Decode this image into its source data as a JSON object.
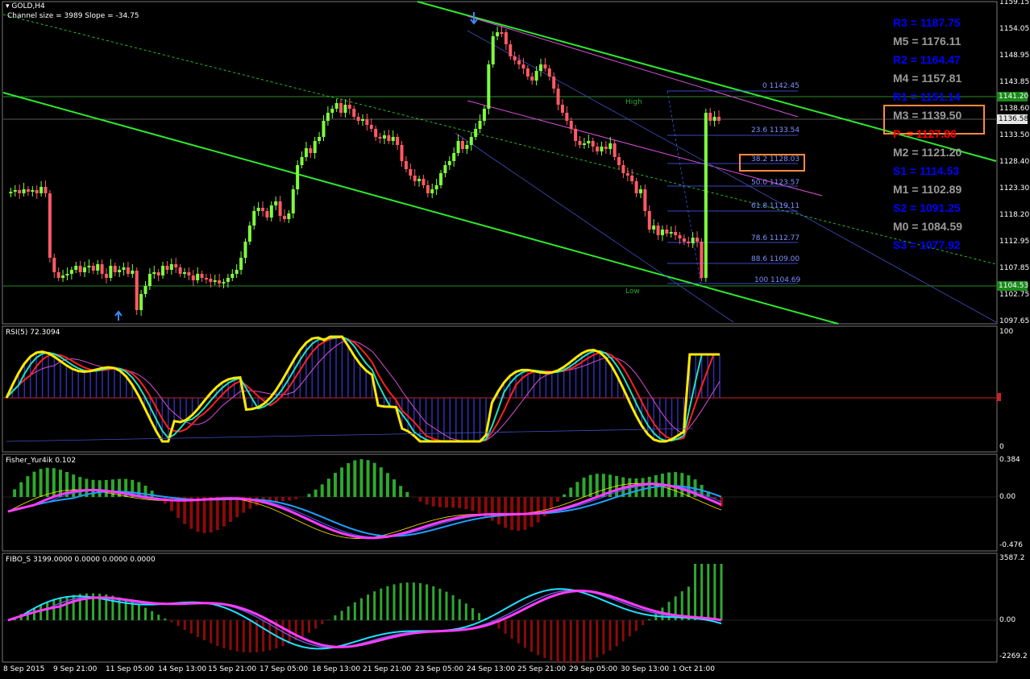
{
  "main_chart": {
    "symbol": "GOLD,H4",
    "channel_info": "Channel size = 3989 Slope = -34.75",
    "price_axis": [
      "1159.15",
      "1154.05",
      "1148.95",
      "1143.85",
      "1138.60",
      "1133.50",
      "1128.40",
      "1123.30",
      "1118.20",
      "1112.95",
      "1107.85",
      "1102.75",
      "1097.65"
    ],
    "current_price_tag": "1136.58",
    "high_tag": "1141.20",
    "low_tag": "1104.53",
    "high_label": "High",
    "low_label": "Low",
    "fibo_levels": [
      "0 1142.45",
      "23.6 1133.54",
      "38.2 1128.03",
      "50.0 1123.57",
      "61.8 1119.11",
      "78.6 1112.77",
      "88.6 1109.00",
      "100 1104.69"
    ],
    "pivots": [
      {
        "label": "R3 = 1187.75",
        "color": "#0000ff"
      },
      {
        "label": "M5 = 1176.11",
        "color": "#9a9a9a"
      },
      {
        "label": "R2 = 1164.47",
        "color": "#0000ff"
      },
      {
        "label": "M4 = 1157.81",
        "color": "#9a9a9a"
      },
      {
        "label": "R1 = 1151.14",
        "color": "#0000ff"
      },
      {
        "label": "M3 = 1139.50",
        "color": "#9a9a9a"
      },
      {
        "label": "P  = 1127.86",
        "color": "#ff0000"
      },
      {
        "label": "M2 = 1121.20",
        "color": "#9a9a9a"
      },
      {
        "label": "S1 = 1114.53",
        "color": "#0000ff"
      },
      {
        "label": "M1 = 1102.89",
        "color": "#9a9a9a"
      },
      {
        "label": "S2 = 1091.25",
        "color": "#0000ff"
      },
      {
        "label": "M0 = 1084.59",
        "color": "#9a9a9a"
      },
      {
        "label": "S3 = 1077.92",
        "color": "#0000ff"
      }
    ]
  },
  "rsi_panel": {
    "title": "RSI(5) 72.3094",
    "axis": [
      "100",
      "0"
    ]
  },
  "fisher_panel": {
    "title": "Fisher_Yur4ik 0.102",
    "axis": [
      "0.384",
      "0.00",
      "-0.476"
    ]
  },
  "fibo_panel": {
    "title": "FIBO_S 3199.0000 0.0000 0.0000 0.0000",
    "axis": [
      "3587.2",
      "0.00",
      "-2269.2"
    ]
  },
  "time_axis": [
    "8 Sep 2015",
    "9 Sep 21:00",
    "11 Sep 05:00",
    "14 Sep 13:00",
    "15 Sep 21:00",
    "17 Sep 05:00",
    "18 Sep 13:00",
    "21 Sep 21:00",
    "23 Sep 05:00",
    "24 Sep 13:00",
    "25 Sep 21:00",
    "29 Sep 05:00",
    "30 Sep 13:00",
    "1 Oct 21:00"
  ],
  "colors": {
    "bull": "#7fff3f",
    "bear": "#ff5a66",
    "channel": "#2ee82e",
    "fib": "#6a7fff",
    "pink": "#d94fd9",
    "rsi": "#ffea00",
    "box": "#ff8a3c"
  }
}
